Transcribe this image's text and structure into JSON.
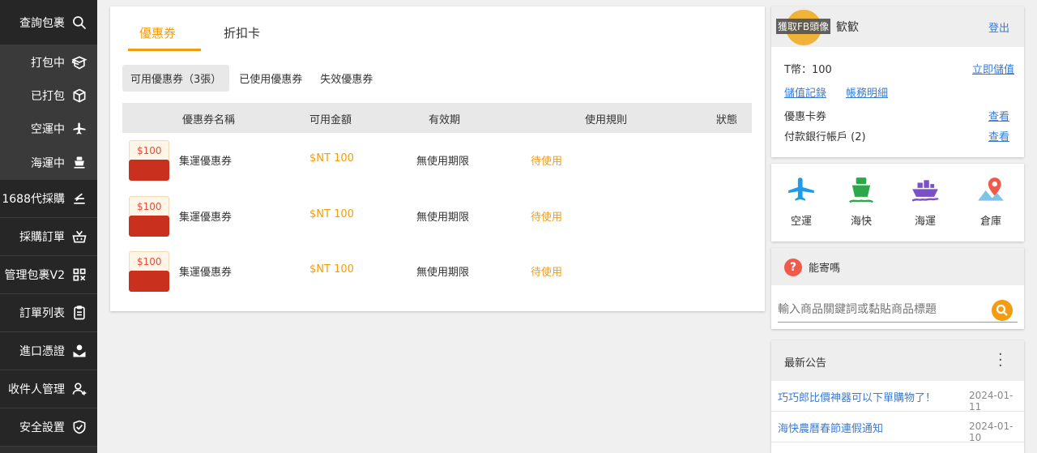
{
  "sidebar": {
    "items": [
      {
        "label": "查詢包裹",
        "icon": "search-icon"
      },
      {
        "label": "打包中",
        "icon": "package-open-icon"
      },
      {
        "label": "已打包",
        "icon": "package-icon"
      },
      {
        "label": "空運中",
        "icon": "airplane-icon"
      },
      {
        "label": "海運中",
        "icon": "ship-icon"
      },
      {
        "label": "1688代採購",
        "icon": "purchase-icon"
      },
      {
        "label": "採購訂單",
        "icon": "basket-icon"
      },
      {
        "label": "管理包裹V2",
        "icon": "manage-icon"
      },
      {
        "label": "訂單列表",
        "icon": "clipboard-icon"
      },
      {
        "label": "進口憑證",
        "icon": "certificate-icon"
      },
      {
        "label": "收件人管理",
        "icon": "user-add-icon"
      },
      {
        "label": "安全設置",
        "icon": "shield-check-icon"
      }
    ]
  },
  "main": {
    "tabs": [
      {
        "label": "優惠券",
        "active": true
      },
      {
        "label": "折扣卡",
        "active": false
      }
    ],
    "filters": [
      {
        "label": "可用優惠券（3張）",
        "active": true
      },
      {
        "label": "已使用優惠券",
        "active": false
      },
      {
        "label": "失效優惠券",
        "active": false
      }
    ],
    "columns": [
      "優惠券名稱",
      "可用金額",
      "有效期",
      "使用規則",
      "狀態"
    ],
    "rows": [
      {
        "badge": "$100",
        "name": "集運優惠券",
        "amount": "$NT 100",
        "validity": "無使用期限",
        "rule": "待使用"
      },
      {
        "badge": "$100",
        "name": "集運優惠券",
        "amount": "$NT 100",
        "validity": "無使用期限",
        "rule": "待使用"
      },
      {
        "badge": "$100",
        "name": "集運優惠券",
        "amount": "$NT 100",
        "validity": "無使用期限",
        "rule": "待使用"
      }
    ],
    "accent_color": "#f39c12"
  },
  "account": {
    "avatar_tag": "獲取FB頭像",
    "username": "歓歓",
    "logout": "登出",
    "balance_label": "T幣：100",
    "topup": "立即儲值",
    "topup_record": "儲值記錄",
    "account_detail": "帳務明細",
    "coupon_card_label": "優惠卡券",
    "coupon_card_link": "查看",
    "bank_label": "付款銀行帳戶 (2)",
    "bank_link": "查看"
  },
  "services": [
    {
      "label": "空運",
      "icon": "airplane-icon"
    },
    {
      "label": "海快",
      "icon": "ferry-icon"
    },
    {
      "label": "海運",
      "icon": "cargo-ship-icon"
    },
    {
      "label": "倉庫",
      "icon": "map-pin-icon"
    }
  ],
  "can_ship": {
    "title": "能寄嗎",
    "placeholder": "輸入商品關鍵詞或黏貼商品標題"
  },
  "news": {
    "title": "最新公告",
    "items": [
      {
        "title": "巧巧郎比價神器可以下單購物了！",
        "date": "2024-01-11"
      },
      {
        "title": "海快農曆春節連假通知",
        "date": "2024-01-10"
      }
    ]
  }
}
